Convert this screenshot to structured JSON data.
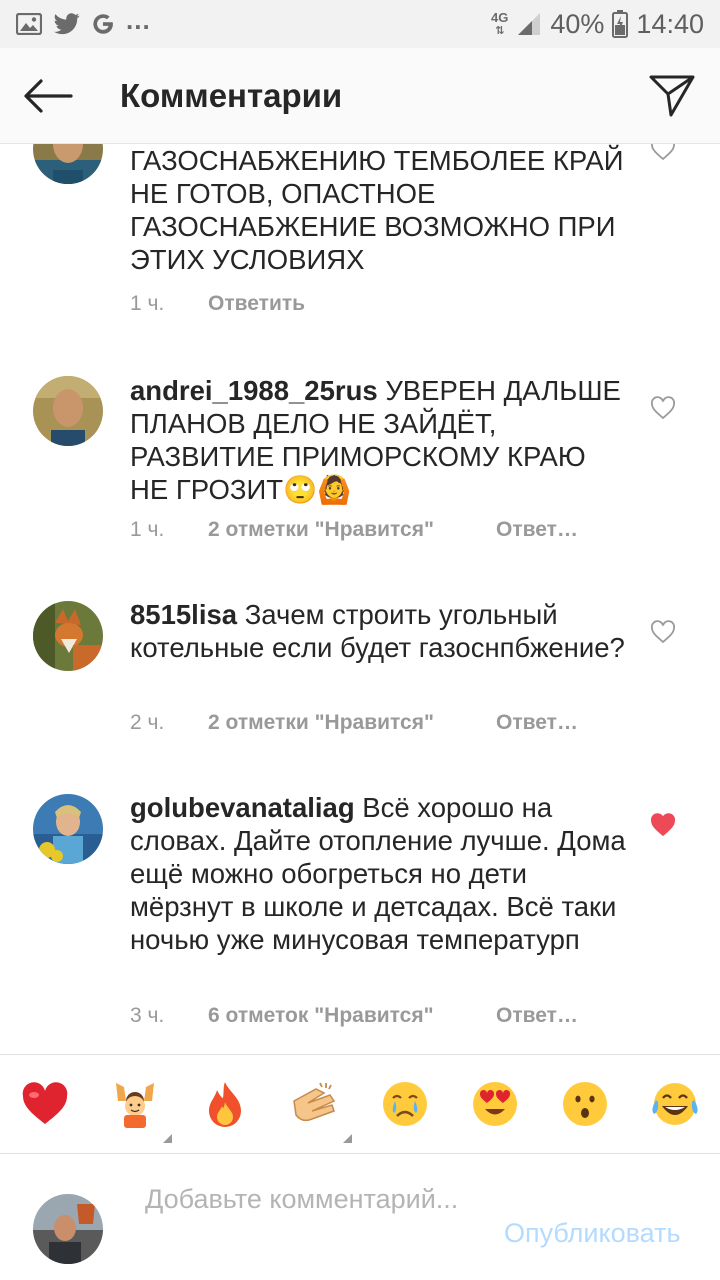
{
  "status_bar": {
    "network": "4G",
    "battery": "40%",
    "time": "14:40",
    "overflow": "..."
  },
  "header": {
    "title": "Комментарии"
  },
  "comments": [
    {
      "username": "",
      "text": "ГАЗОСНАБЖЕНИЮ ТЕМБОЛЕЕ КРАЙ НЕ ГОТОВ, ОПАСТНОЕ ГАЗОСНАБЖЕНИЕ ВОЗМОЖНО ПРИ ЭТИХ УСЛОВИЯХ",
      "time": "1 ч.",
      "likes": "",
      "reply": "Ответить",
      "liked": false
    },
    {
      "username": "andrei_1988_25rus",
      "text": "УВЕРЕН ДАЛЬШЕ ПЛАНОВ ДЕЛО НЕ ЗАЙДЁТ, РАЗВИТИЕ ПРИМОРСКОМУ КРАЮ НЕ ГРОЗИТ🙄🙆",
      "time": "1 ч.",
      "likes": "2 отметки \"Нравится\"",
      "reply": "Ответ…",
      "liked": false
    },
    {
      "username": "8515lisa",
      "text": "Зачем строить угольный котельные если будет газоснпбжение?",
      "time": "2 ч.",
      "likes": "2 отметки \"Нравится\"",
      "reply": "Ответ…",
      "liked": false
    },
    {
      "username": "golubevanataliag",
      "text": "Всё хорошо на словах. Дайте отопление лучше. Дома ещё можно обогреться  но дети мёрзнут в школе и детсадах. Всё таки ночью уже минусовая температурп",
      "time": "3 ч.",
      "likes": "6 отметок \"Нравится\"",
      "reply": "Ответ…",
      "liked": true
    }
  ],
  "emoji_bar": [
    "red-heart",
    "raising-hands",
    "fire",
    "clapping-hands",
    "crying-face",
    "heart-eyes-face",
    "surprised-face",
    "tears-of-joy-face"
  ],
  "comment_input": {
    "placeholder": "Добавьте комментарий...",
    "value": "",
    "publish_label": "Опубликовать"
  },
  "colors": {
    "like_active": "#ed4956",
    "publish_disabled": "#b3dbff",
    "meta_text": "#999999"
  }
}
